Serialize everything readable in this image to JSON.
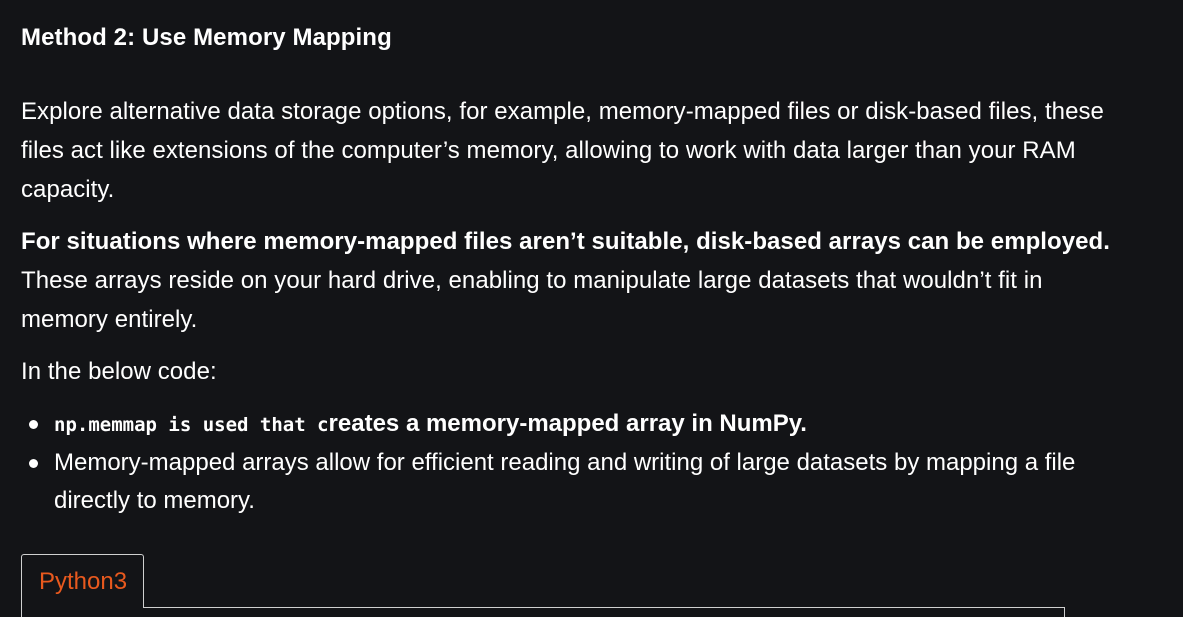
{
  "article": {
    "heading": "Method 2: Use Memory Mapping",
    "paragraph1": "Explore alternative data storage options, for example, memory-mapped files or disk-based files, these files act like extensions of the computer’s memory, allowing to work with data larger than your RAM capacity.",
    "paragraph2_bold": "For situations where memory-mapped files aren’t suitable, disk-based arrays can be employed.",
    "paragraph2_rest": " These arrays reside on your hard drive, enabling to manipulate large datasets that wouldn’t fit in memory entirely.",
    "paragraph3": "In the below code:",
    "bullets": [
      {
        "code": "np.memmap is used that c",
        "text": "reates a memory-mapped array in NumPy."
      },
      {
        "text": "Memory-mapped arrays allow for efficient reading and writing of large datasets by mapping a file directly to memory."
      }
    ]
  },
  "code_tabs": {
    "tabs": [
      {
        "label": "Python3",
        "active": true
      }
    ]
  },
  "colors": {
    "background": "#131417",
    "text": "#ffffff",
    "tab_label": "#e8591e",
    "tab_border": "#d0d0d0"
  }
}
